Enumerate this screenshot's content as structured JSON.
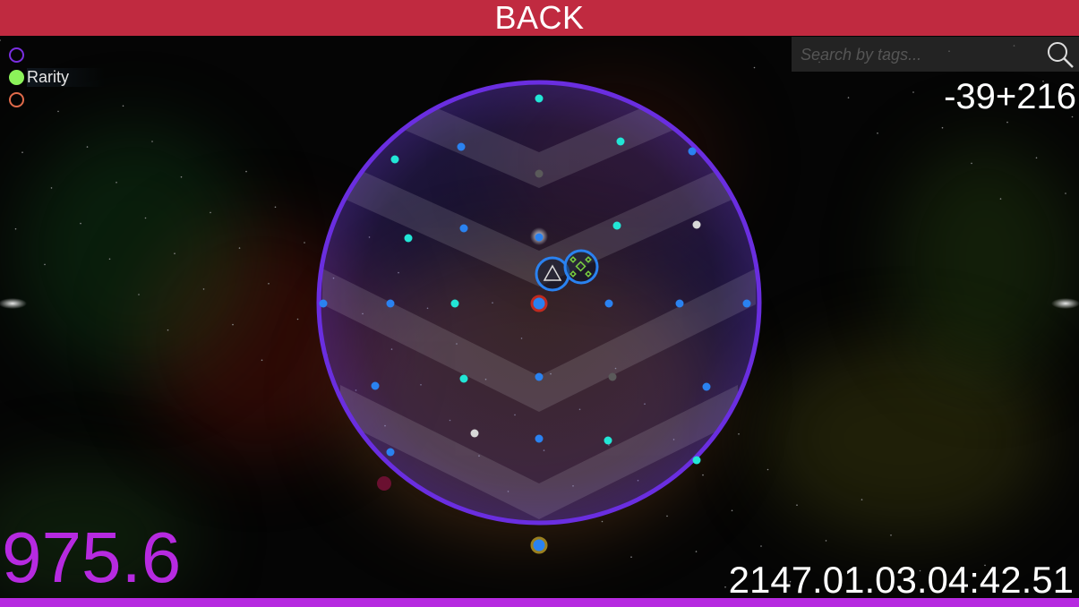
{
  "header": {
    "back_label": "BACK"
  },
  "legend": {
    "items": [
      {
        "label": "",
        "color": "#7a2ee0",
        "filled": false
      },
      {
        "label": "Rarity",
        "color": "#8cf25a",
        "filled": true
      },
      {
        "label": "",
        "color": "#e06a4a",
        "filled": false
      }
    ]
  },
  "search": {
    "placeholder": "Search by tags...",
    "value": "",
    "icon": "search-icon"
  },
  "coordinates": "-39+216",
  "energy_value": "975.6",
  "timestamp": "2147.01.03.04:42.51",
  "colors": {
    "back_bar": "#c02a40",
    "accent_purple": "#b62ae0",
    "sector_ring": "#6a2ee0",
    "star_blue": "#2a82f0",
    "star_cyan": "#22e6d6",
    "star_white": "#d8d8d8",
    "star_grey": "#5a5a5a"
  },
  "map": {
    "sector_ring": "purple-circle",
    "player_ship": "triangle-icon",
    "station": "diamond-cluster-icon"
  }
}
